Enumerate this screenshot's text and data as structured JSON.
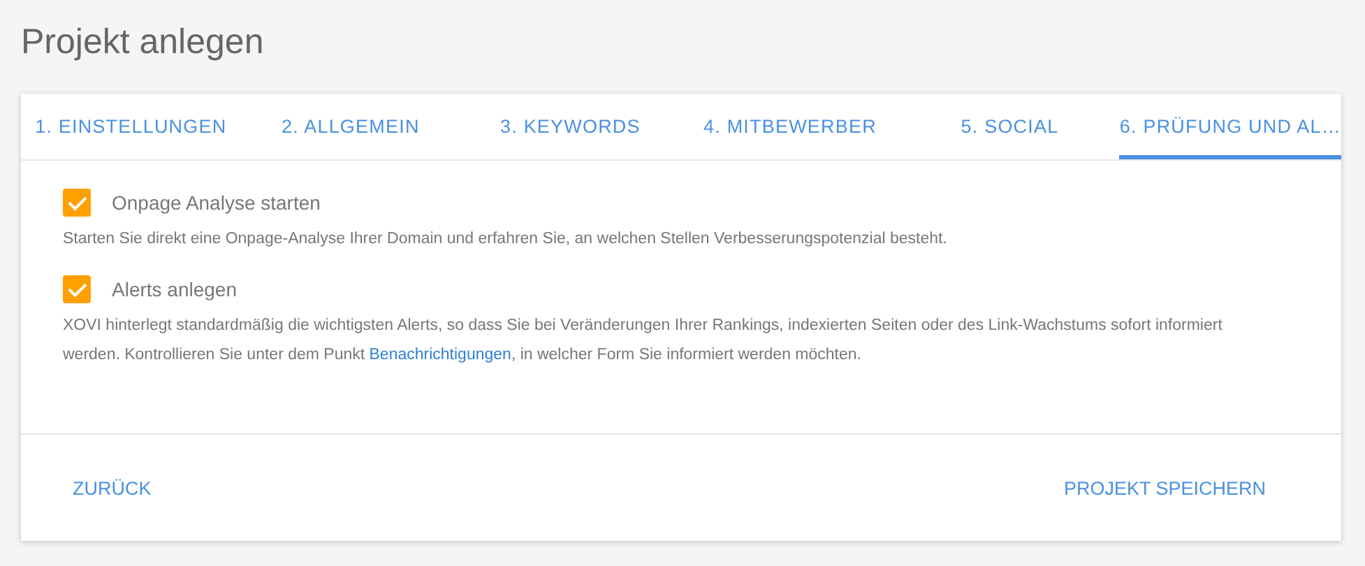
{
  "page_title": "Projekt anlegen",
  "tabs": [
    {
      "label": "1. EINSTELLUNGEN",
      "selected": false
    },
    {
      "label": "2. ALLGEMEIN",
      "selected": false
    },
    {
      "label": "3. KEYWORDS",
      "selected": false
    },
    {
      "label": "4. MITBEWERBER",
      "selected": false
    },
    {
      "label": "5. SOCIAL",
      "selected": false
    },
    {
      "label": "6. PRÜFUNG UND AL…",
      "selected": true
    }
  ],
  "options": [
    {
      "label": "Onpage Analyse starten",
      "checked": true,
      "description": {
        "text": "Starten Sie direkt eine Onpage-Analyse Ihrer Domain und erfahren Sie, an welchen Stellen Verbesserungspotenzial besteht."
      }
    },
    {
      "label": "Alerts anlegen",
      "checked": true,
      "description": {
        "text": "XOVI hinterlegt standardmäßig die wichtigsten Alerts, so dass Sie bei Veränderungen Ihrer Rankings, indexierten Seiten oder des Link-Wachstums sofort informiert werden. Kontrollieren Sie unter dem Punkt ",
        "link": "Benachrichtigungen",
        "after": ", in welcher Form Sie informiert werden möchten."
      }
    }
  ],
  "buttons": {
    "back": "ZURÜCK",
    "save": "PROJEKT SPEICHERN"
  }
}
